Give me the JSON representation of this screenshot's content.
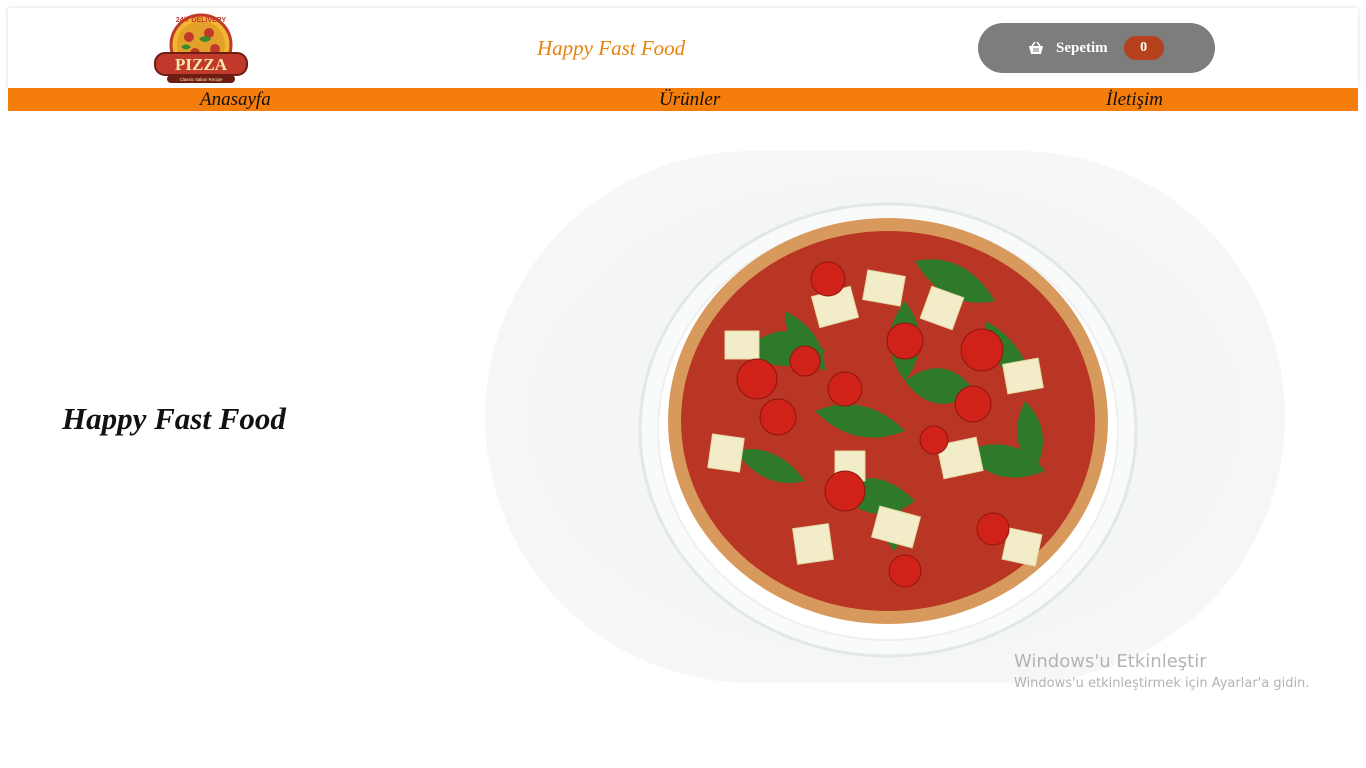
{
  "header": {
    "logo": {
      "top_text": "24/7 DELIVERY",
      "main_text": "PIZZA",
      "sub_text": "Classic Italian Recipe"
    },
    "brand_title": "Happy Fast Food",
    "cart": {
      "icon": "basket-icon",
      "label": "Sepetim",
      "count": "0"
    }
  },
  "nav": {
    "items": [
      {
        "label": "Anasayfa"
      },
      {
        "label": "Ürünler"
      },
      {
        "label": "İletişim"
      }
    ]
  },
  "hero": {
    "title": "Happy Fast Food",
    "image": "pizza-with-arugula-tomatoes-parmesan"
  },
  "system_overlay": {
    "title": "Windows'u Etkinleştir",
    "subtitle": "Windows'u etkinleştirmek için Ayarlar'a gidin."
  },
  "colors": {
    "accent_orange": "#f47d0b",
    "brand_text": "#e8820c",
    "cart_bg": "#7d7d7d",
    "cart_badge": "#b5421d"
  }
}
